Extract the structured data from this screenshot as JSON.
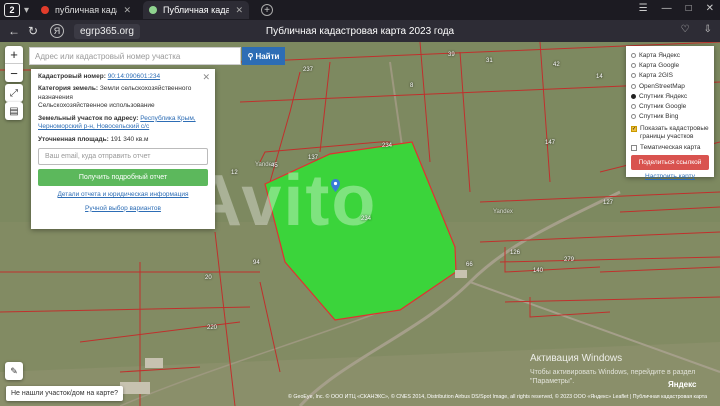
{
  "browser": {
    "tab_count": "2",
    "tabs": [
      {
        "title": "публичная кадастровая",
        "favicon_color": "#e23c2b"
      },
      {
        "title": "Публичная кадастровая",
        "favicon_color": "#8fd38f"
      }
    ],
    "domain": "egrp365.org",
    "page_title": "Публичная кадастровая карта 2023 года"
  },
  "search": {
    "placeholder": "Адрес или кадастровый номер участка",
    "button_label": "Найти"
  },
  "info_panel": {
    "cadastral_label": "Кадастровый номер:",
    "cadastral_number": "90:14:090601:234",
    "category_label": "Категория земель:",
    "category_value": "Земли сельскохозяйственного назначения",
    "usage": "Сельскохозяйственное использование",
    "address_label": "Земельный участок по адресу:",
    "address_value": "Республика Крым, Черноморский р-н, Новосельский с/с",
    "area_label": "Уточненная площадь:",
    "area_value": "191 340 кв.м",
    "email_placeholder": "Ваш email, куда отправить отчет",
    "get_report_button": "Получить подробный отчет",
    "report_details_link": "Детали отчета и юридическая информация",
    "manual_select_link": "Ручной выбор вариантов"
  },
  "layers": {
    "options": [
      {
        "label": "Карта Яндекс",
        "selected": false
      },
      {
        "label": "Карта Google",
        "selected": false
      },
      {
        "label": "Карта 2GIS",
        "selected": false
      },
      {
        "label": "OpenStreetMap",
        "selected": false
      },
      {
        "label": "Спутник Яндекс",
        "selected": true
      },
      {
        "label": "Спутник Google",
        "selected": false
      },
      {
        "label": "Спутник Bing",
        "selected": false
      }
    ],
    "checkbox_borders": "Показать кадастровые границы участков",
    "checkbox_thematic": "Тематическая карта",
    "share_button": "Поделиться ссылкой",
    "configure_link": "Настроить карту"
  },
  "map": {
    "parcel_labels": [
      "234",
      "234",
      "137",
      "45",
      "12",
      "94",
      "20",
      "39",
      "14",
      "147",
      "127",
      "126",
      "66",
      "220",
      "140",
      "279",
      "237",
      "42",
      "8",
      "31"
    ],
    "place_labels": [
      "Yandex",
      "Yandex"
    ],
    "watermark": "Avito",
    "parcel_color": "#3bd43b",
    "border_color": "#c0302c"
  },
  "bottom": {
    "not_found_label": "Не нашли участок/дом на карте?",
    "copyright": "© GeoEye, Inc. © ООО ИТЦ «СКАНЭКС», © CNES 2014, Distribution Airbus DS/Spot Image, all rights reserved, © 2023 ООО «Яндекс»  Leaflet | Публичная кадастровая карта",
    "activation_title": "Активация Windows",
    "activation_text": "Чтобы активировать Windows, перейдите в раздел \"Параметры\".",
    "yandex_logo": "Яндекс"
  }
}
